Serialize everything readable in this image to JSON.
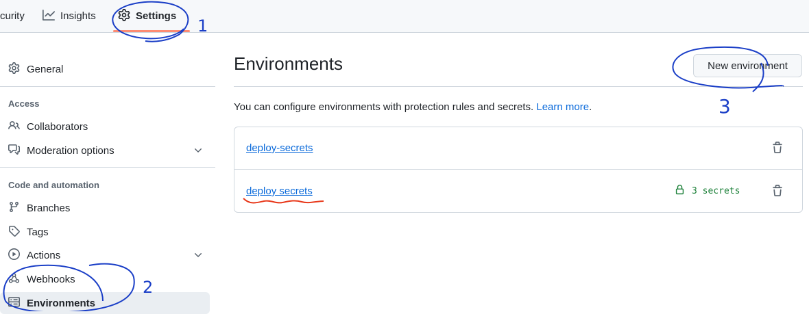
{
  "tabs": [
    {
      "label": "curity",
      "icon": "none"
    },
    {
      "label": "Insights",
      "icon": "graph-icon"
    },
    {
      "label": "Settings",
      "icon": "gear-icon",
      "active": true
    }
  ],
  "sidebar": {
    "general": {
      "label": "General",
      "icon": "gear-icon"
    },
    "access_heading": "Access",
    "access_items": [
      {
        "label": "Collaborators",
        "icon": "people-icon"
      },
      {
        "label": "Moderation options",
        "icon": "comment-discussion-icon",
        "expandable": true
      }
    ],
    "code_heading": "Code and automation",
    "code_items": [
      {
        "label": "Branches",
        "icon": "git-branch-icon"
      },
      {
        "label": "Tags",
        "icon": "tag-icon"
      },
      {
        "label": "Actions",
        "icon": "play-icon",
        "expandable": true
      },
      {
        "label": "Webhooks",
        "icon": "webhook-icon"
      },
      {
        "label": "Environments",
        "icon": "server-icon",
        "selected": true
      }
    ]
  },
  "main": {
    "title": "Environments",
    "new_button_label": "New environment",
    "description": "You can configure environments with protection rules and secrets.",
    "learn_more": "Learn more",
    "learn_more_suffix": ".",
    "environments": [
      {
        "name": "deploy-secrets",
        "secrets": ""
      },
      {
        "name": "deploy secrets",
        "secrets": "3 secrets"
      }
    ]
  },
  "annotations": {
    "marks": [
      "1",
      "2",
      "3"
    ],
    "colors": {
      "ink": "#1b3fc7",
      "underline": "#e8391b"
    }
  },
  "colors": {
    "link": "#0969da",
    "success": "#1a7f37",
    "border": "#d0d7de",
    "tab_underline": "#fd8c73"
  }
}
